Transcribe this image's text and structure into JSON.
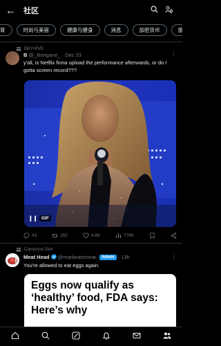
{
  "header": {
    "title": "社区"
  },
  "chips": [
    "育",
    "时尚与美容",
    "健康与健身",
    "消息",
    "加密货币",
    "旅行"
  ],
  "post1": {
    "community": "BEYHIVE",
    "author_name": "B",
    "handle": "@_Bongane_",
    "dot": "·",
    "date": "Dec 23",
    "text": "y'all, is Netflix finna upload the performance afterwards, or do I gotta screen record???",
    "gif_label": "GIF",
    "replies": "43",
    "reposts": "162",
    "likes": "4.8K",
    "views": "778K"
  },
  "post2": {
    "community": "Carnivore Diet",
    "author_name": "Meat Head",
    "handle": "@markeatsmeat",
    "badge": "Admin",
    "dot": "·",
    "time": "13h",
    "text": "You're allowed to eat eggs again.",
    "headline": "Eggs now qualify as ‘healthy’ food, FDA says: Here’s why"
  },
  "colors": {
    "accent": "#1d9bf0",
    "bg": "#000000",
    "muted": "#71767b"
  },
  "icons": [
    "back-arrow-icon",
    "search-icon",
    "community-settings-icon",
    "more-icon",
    "reply-icon",
    "repost-icon",
    "like-icon",
    "views-icon",
    "bookmark-icon",
    "share-icon",
    "home-icon",
    "explore-icon",
    "grok-icon",
    "notifications-icon",
    "messages-icon",
    "communities-icon"
  ]
}
